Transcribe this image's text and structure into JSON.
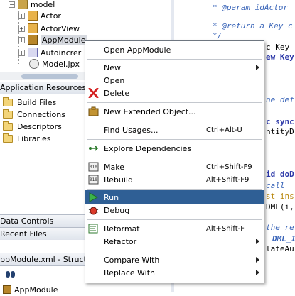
{
  "tree": {
    "items": [
      {
        "label": "model"
      },
      {
        "label": "Actor"
      },
      {
        "label": "ActorView"
      },
      {
        "label": "AppModule"
      },
      {
        "label": "Autoincrer"
      },
      {
        "label": "Model.jpx"
      }
    ]
  },
  "resources": {
    "title": "Application Resources",
    "items": [
      {
        "label": "Build Files"
      },
      {
        "label": "Connections"
      },
      {
        "label": "Descriptors"
      },
      {
        "label": "Libraries"
      }
    ]
  },
  "panels": {
    "data_controls": "Data Controls",
    "recent_files": "Recent Files",
    "structure": "ppModule.xml - Struct",
    "structure_root": "AppModule"
  },
  "editor": {
    "lines": [
      "* @param idActor",
      "* @return a Key c",
      "*/",
      "c Key",
      "ew Key",
      "ne def",
      "c sync",
      "ntityD",
      "id doD",
      "call",
      "st ins",
      "DML(i,",
      "the re",
      "DML_I",
      "lateAu"
    ]
  },
  "context_menu": {
    "items": [
      {
        "label": "Open AppModule",
        "shortcut": ""
      },
      {
        "label": "New",
        "shortcut": ""
      },
      {
        "label": "Open",
        "shortcut": ""
      },
      {
        "label": "Delete",
        "shortcut": ""
      },
      {
        "label": "New Extended Object...",
        "shortcut": ""
      },
      {
        "label": "Find Usages...",
        "shortcut": "Ctrl+Alt-U"
      },
      {
        "label": "Explore Dependencies",
        "shortcut": ""
      },
      {
        "label": "Make",
        "shortcut": "Ctrl+Shift-F9"
      },
      {
        "label": "Rebuild",
        "shortcut": "Alt+Shift-F9"
      },
      {
        "label": "Run",
        "shortcut": ""
      },
      {
        "label": "Debug",
        "shortcut": ""
      },
      {
        "label": "Reformat",
        "shortcut": "Alt+Shift-F"
      },
      {
        "label": "Refactor",
        "shortcut": ""
      },
      {
        "label": "Compare With",
        "shortcut": ""
      },
      {
        "label": "Replace With",
        "shortcut": ""
      }
    ],
    "highlight_color": "#2f5f95"
  },
  "colors": {
    "comment": "#3b66b9",
    "keyword": "#2c38a8",
    "selection": "#d6d9df"
  }
}
